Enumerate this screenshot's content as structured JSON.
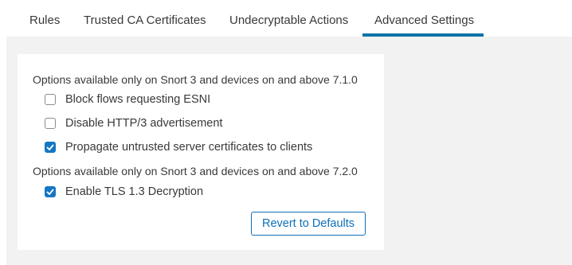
{
  "tabs": [
    {
      "label": "Rules",
      "active": false
    },
    {
      "label": "Trusted CA Certificates",
      "active": false
    },
    {
      "label": "Undecryptable Actions",
      "active": false
    },
    {
      "label": "Advanced Settings",
      "active": true
    }
  ],
  "sections": [
    {
      "heading": "Options available only on Snort 3 and devices on and above 7.1.0",
      "options": [
        {
          "label": "Block flows requesting ESNI",
          "checked": false
        },
        {
          "label": "Disable HTTP/3 advertisement",
          "checked": false
        },
        {
          "label": "Propagate untrusted server certificates to clients",
          "checked": true
        }
      ]
    },
    {
      "heading": "Options available only on Snort 3 and devices on and above 7.2.0",
      "options": [
        {
          "label": "Enable TLS 1.3 Decryption",
          "checked": true
        }
      ]
    }
  ],
  "revert_button_label": "Revert to Defaults",
  "colors": {
    "accent": "#0d74a8",
    "checkbox_checked": "#1477c4",
    "content_background": "#f2f2f2",
    "text": "#39393b"
  }
}
